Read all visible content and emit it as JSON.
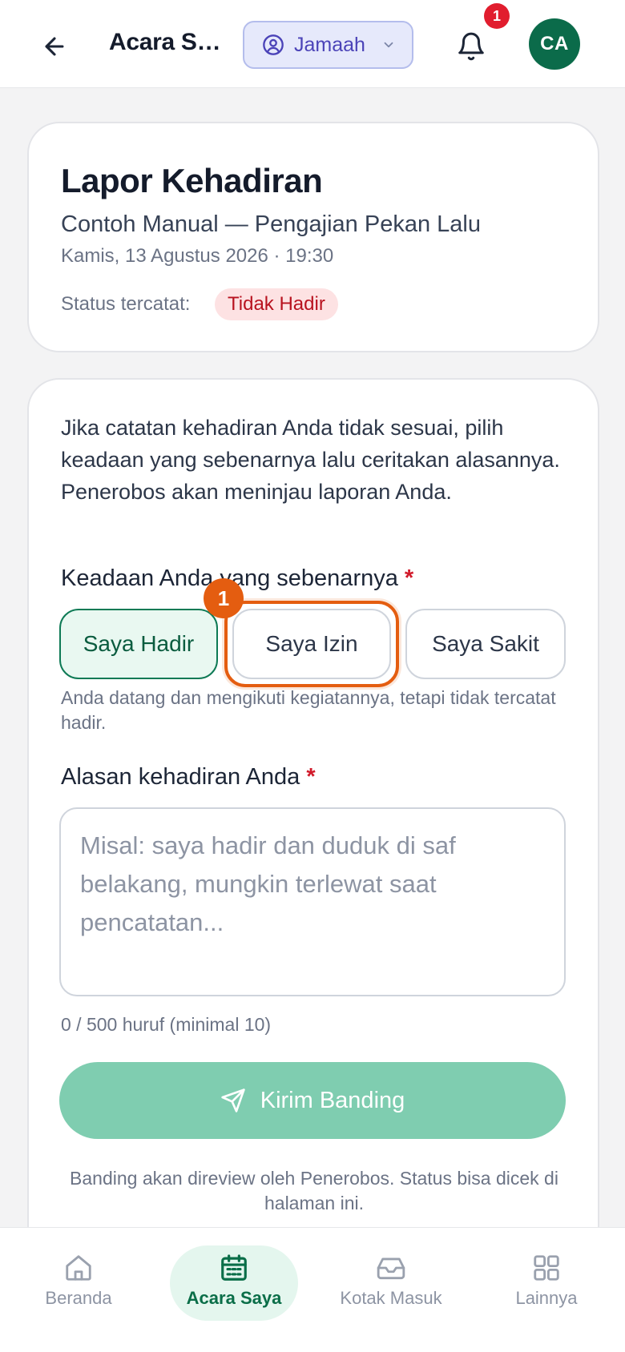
{
  "header": {
    "back_icon": "arrow-left-icon",
    "title": "Acara Sa...",
    "role": {
      "label": "Jamaah",
      "icon": "user-circle-icon"
    },
    "notifications": {
      "icon": "bell-icon",
      "badge": "1"
    },
    "avatar_initials": "CA"
  },
  "event_card": {
    "title": "Lapor Kehadiran",
    "event_name": "Contoh Manual — Pengajian Pekan Lalu",
    "datetime": "Kamis, 13 Agustus 2026 · 19:30",
    "status_label": "Status tercatat:",
    "status_value": "Tidak Hadir"
  },
  "form": {
    "intro": "Jika catatan kehadiran Anda tidak sesuai, pilih keadaan yang sebenarnya lalu ceritakan alasannya. Penerobos akan meninjau laporan Anda.",
    "state_label": "Keadaan Anda yang sebenarnya",
    "required_mark": "*",
    "options": [
      {
        "label": "Saya Hadir",
        "selected": true
      },
      {
        "label": "Saya Izin",
        "selected": false
      },
      {
        "label": "Saya Sakit",
        "selected": false
      }
    ],
    "highlight_step": "1",
    "option_help": "Anda datang dan mengikuti kegiatannya, tetapi tidak tercatat hadir.",
    "reason_label": "Alasan kehadiran Anda",
    "reason_value": "",
    "reason_placeholder": "Misal: saya hadir dan duduk di saf belakang, mungkin terlewat saat pencatatan...",
    "counter": "0 / 500 huruf (minimal 10)",
    "submit_label": "Kirim Banding",
    "submit_icon": "send-icon",
    "footnote": "Banding akan direview oleh Penerobos. Status bisa dicek di halaman ini."
  },
  "bottom_nav": [
    {
      "label": "Beranda",
      "icon": "home-icon",
      "active": false
    },
    {
      "label": "Acara Saya",
      "icon": "calendar-icon",
      "active": true
    },
    {
      "label": "Kotak Masuk",
      "icon": "inbox-icon",
      "active": false
    },
    {
      "label": "Lainnya",
      "icon": "grid-icon",
      "active": false
    }
  ],
  "colors": {
    "primary_green": "#0e7a55",
    "submit_disabled": "#7fcdb0",
    "highlight_orange": "#e45d10",
    "role_accent": "#4b43b8",
    "danger": "#d11a2a"
  }
}
